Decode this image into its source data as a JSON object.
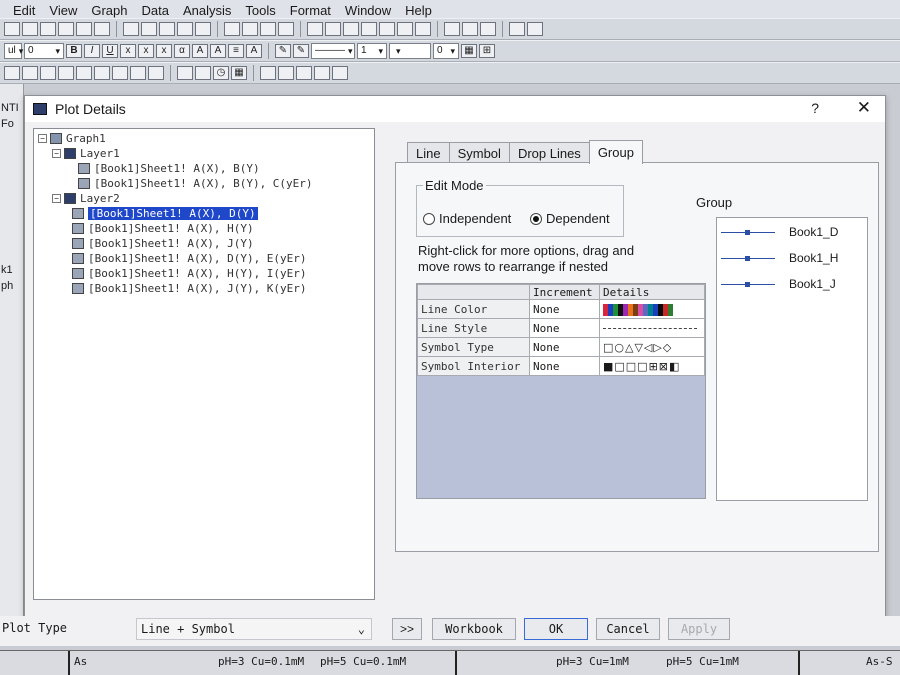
{
  "menubar": [
    "Edit",
    "View",
    "Graph",
    "Data",
    "Analysis",
    "Tools",
    "Format",
    "Window",
    "Help"
  ],
  "toolbar": {
    "font_combo": "ul",
    "size_combo": "0",
    "line_width_combo": "1",
    "pattern_combo": "0"
  },
  "left_strip": [
    "NTI",
    "Fo",
    "k1",
    "ph"
  ],
  "dialog": {
    "title": "Plot Details",
    "help": "?",
    "close": "✕"
  },
  "tree": {
    "nodes": [
      {
        "level": 0,
        "label": "Graph1",
        "expander": "−"
      },
      {
        "level": 1,
        "label": "Layer1",
        "expander": "−"
      },
      {
        "level": 2,
        "label": "[Book1]Sheet1! A(X), B(Y)"
      },
      {
        "level": 2,
        "label": "[Book1]Sheet1! A(X), B(Y), C(yEr)"
      },
      {
        "level": 1,
        "label": "Layer2",
        "expander": "−"
      },
      {
        "level": 2,
        "label": "[Book1]Sheet1! A(X), D(Y)",
        "selected": true
      },
      {
        "level": 2,
        "label": "[Book1]Sheet1! A(X), H(Y)"
      },
      {
        "level": 2,
        "label": "[Book1]Sheet1! A(X), J(Y)"
      },
      {
        "level": 2,
        "label": "[Book1]Sheet1! A(X), D(Y), E(yEr)"
      },
      {
        "level": 2,
        "label": "[Book1]Sheet1! A(X), H(Y), I(yEr)"
      },
      {
        "level": 2,
        "label": "[Book1]Sheet1! A(X), J(Y), K(yEr)"
      }
    ]
  },
  "tabs": [
    "Line",
    "Symbol",
    "Drop Lines",
    "Group"
  ],
  "active_tab": "Group",
  "group_tab": {
    "edit_mode_label": "Edit Mode",
    "independent_label": "Independent",
    "dependent_label": "Dependent",
    "selected_mode": "Dependent",
    "hint_line1": "Right-click for more options, drag and",
    "hint_line2": "move rows to  rearrange if nested",
    "grid": {
      "headers": [
        "",
        "Increment",
        "Details"
      ],
      "rows": [
        {
          "name": "Line Color",
          "increment": "None"
        },
        {
          "name": "Line Style",
          "increment": "None"
        },
        {
          "name": "Symbol Type",
          "increment": "None",
          "details": "□○△▽◁▷◇"
        },
        {
          "name": "Symbol Interior",
          "increment": "None",
          "details": "■□□□⊞⊠◧"
        }
      ],
      "color_swatches": [
        "#d7263d",
        "#1b3fbf",
        "#1e8f3a",
        "#111111",
        "#9c27b0",
        "#e8731a",
        "#7a3e12",
        "#d94fa8",
        "#5c6bc0",
        "#00838f",
        "#1b3fbf",
        "#0b0b0b",
        "#c62828",
        "#2e7d32"
      ]
    },
    "group_label": "Group",
    "group_items": [
      "Book1_D",
      "Book1_H",
      "Book1_J"
    ]
  },
  "bottom": {
    "plot_type_label": "Plot Type",
    "plot_type_value": "Line + Symbol",
    "expand_button": ">>",
    "workbook_button": "Workbook",
    "ok_button": "OK",
    "cancel_button": "Cancel",
    "apply_button": "Apply"
  },
  "sheet_strip": [
    "As",
    "pH=3 Cu=0.1mM",
    "pH=5 Cu=0.1mM",
    "pH=3 Cu=1mM",
    "pH=5 Cu=1mM",
    "As-S"
  ]
}
